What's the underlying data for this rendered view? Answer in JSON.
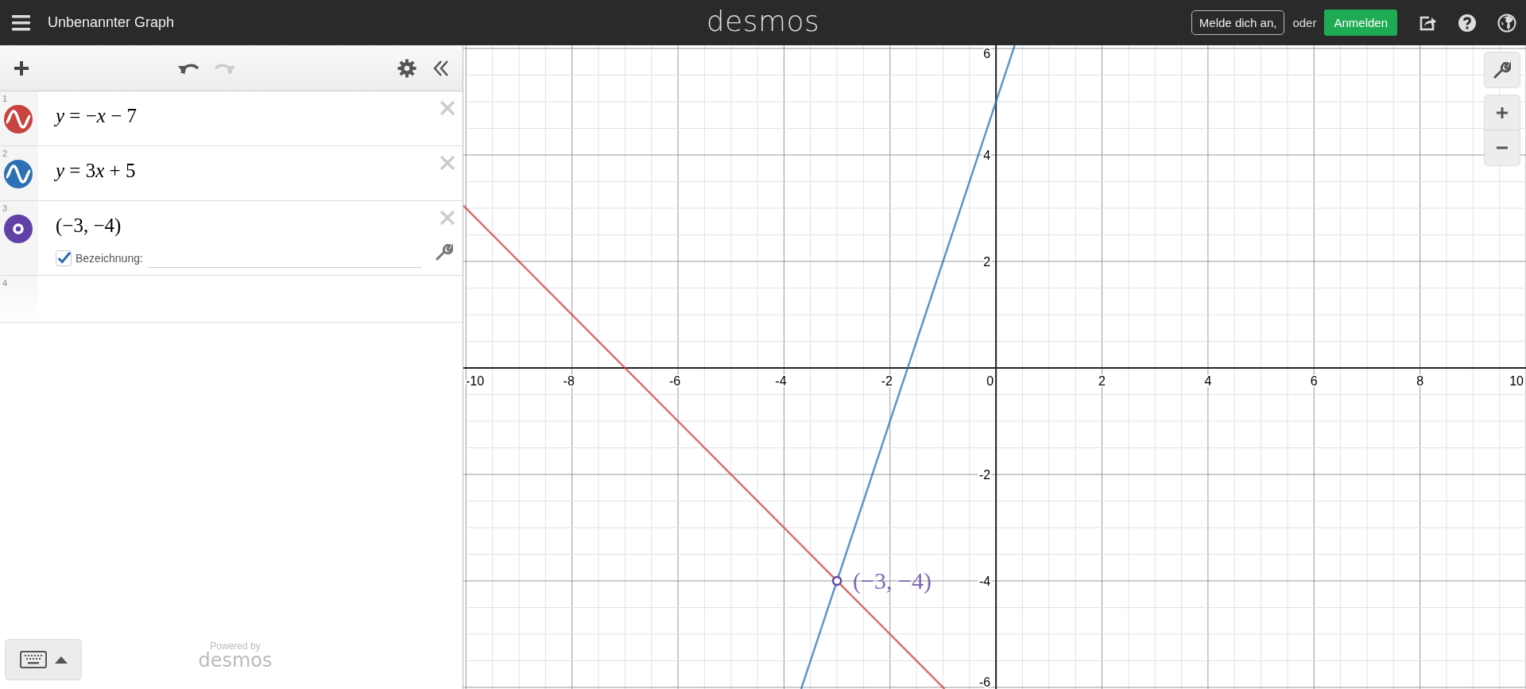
{
  "header": {
    "title": "Unbenannter Graph",
    "logo": "desmos",
    "login_button": "Melde dich an,",
    "or_text": "oder",
    "signup_button": "Anmelden"
  },
  "expressions": [
    {
      "number": "1",
      "kind": "curve",
      "color": "#c74440",
      "latex": "y = −x − 7"
    },
    {
      "number": "2",
      "kind": "curve",
      "color": "#2d70b3",
      "latex": "y = 3x + 5"
    },
    {
      "number": "3",
      "kind": "point",
      "color": "#6042a6",
      "latex": "(−3, −4)",
      "label_checkbox": {
        "label": "Bezeichnung:",
        "checked": true
      }
    },
    {
      "number": "4",
      "kind": "empty"
    }
  ],
  "footer": {
    "powered_by": "Powered by",
    "brand": "desmos"
  },
  "graph": {
    "chart_data": {
      "type": "line",
      "grid": true,
      "x": [
        -10.05,
        -3.677,
        -3,
        -0.97,
        0.353
      ],
      "series": [
        {
          "color": "#c74440",
          "values": [
            3.05,
            -3.323,
            -4,
            -6.03,
            null
          ]
        },
        {
          "color": "#2d70b3",
          "values": [
            null,
            -6.03,
            -4,
            2.09,
            6.06
          ]
        }
      ],
      "xlim": [
        -10.05,
        10
      ],
      "ylim": [
        -6.03,
        6.06
      ],
      "xticks": [
        {
          "value": -10,
          "label": "-10"
        },
        {
          "value": -8,
          "label": "-8"
        },
        {
          "value": -6,
          "label": "-6"
        },
        {
          "value": -4,
          "label": "-4"
        },
        {
          "value": -2,
          "label": "-2"
        },
        {
          "value": 0,
          "label": "0"
        },
        {
          "value": 2,
          "label": "2"
        },
        {
          "value": 4,
          "label": "4"
        },
        {
          "value": 6,
          "label": "6"
        },
        {
          "value": 8,
          "label": "8"
        },
        {
          "value": 10,
          "label": "10"
        }
      ],
      "yticks": [
        {
          "value": -6,
          "label": "-6"
        },
        {
          "value": -4,
          "label": "-4"
        },
        {
          "value": -2,
          "label": "-2"
        },
        {
          "value": 2,
          "label": "2"
        },
        {
          "value": 4,
          "label": "4"
        },
        {
          "value": 6,
          "label": "6"
        }
      ],
      "annotations": [
        {
          "x": -3,
          "y": -4,
          "text": "(−3, −4)"
        }
      ]
    }
  }
}
